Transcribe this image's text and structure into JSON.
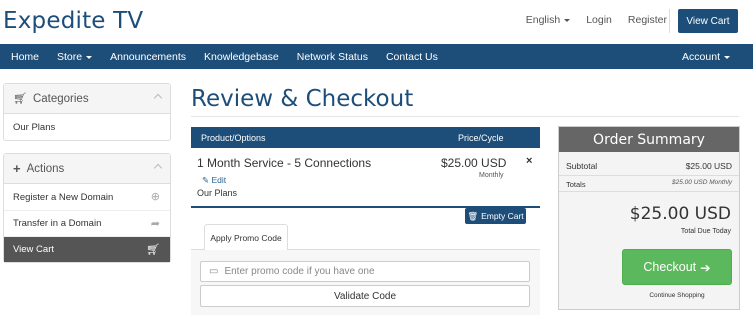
{
  "brand": "Expedite TV",
  "top_links": {
    "language": "English",
    "login": "Login",
    "register": "Register",
    "view_cart": "View Cart"
  },
  "nav": {
    "items": [
      "Home",
      "Store",
      "Announcements",
      "Knowledgebase",
      "Network Status",
      "Contact Us"
    ],
    "account": "Account"
  },
  "sidebar": {
    "categories": {
      "title": "Categories",
      "items": [
        "Our Plans"
      ]
    },
    "actions": {
      "title": "Actions",
      "items": [
        "Register a New Domain",
        "Transfer in a Domain",
        "View Cart"
      ]
    }
  },
  "page_title": "Review & Checkout",
  "cart": {
    "col_product": "Product/Options",
    "col_price": "Price/Cycle",
    "item": {
      "name": "1 Month Service - 5 Connections",
      "edit": "Edit",
      "group": "Our Plans",
      "price": "$25.00 USD",
      "cycle": "Monthly",
      "remove": "×"
    },
    "empty_cart": "Empty Cart"
  },
  "promo": {
    "tab": "Apply Promo Code",
    "placeholder": "Enter promo code if you have one",
    "validate": "Validate Code"
  },
  "summary": {
    "title": "Order Summary",
    "subtotal_label": "Subtotal",
    "subtotal_value": "$25.00 USD",
    "totals_label": "Totals",
    "totals_value": "$25.00 USD Monthly",
    "total_due": "$25.00 USD",
    "total_due_label": "Total Due Today",
    "checkout": "Checkout",
    "continue": "Continue Shopping"
  },
  "colors": {
    "brand": "#1d4e7a",
    "checkout": "#5cb85c",
    "summary_head": "#666666"
  }
}
